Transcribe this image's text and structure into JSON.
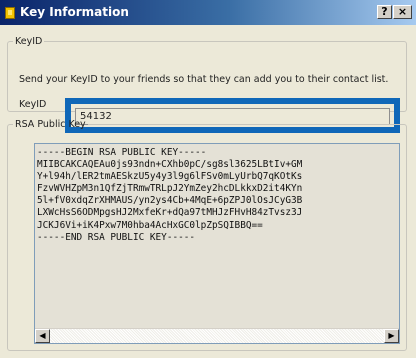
{
  "window": {
    "title": "Key Information",
    "help_label": "?",
    "close_label": "×"
  },
  "keyid_group": {
    "legend": "KeyID",
    "description": "Send your KeyID to your friends so that they can add you to their contact list.",
    "field_label": "KeyID",
    "field_value": "54132"
  },
  "rsa_group": {
    "legend": "RSA Public Key",
    "key_text": "-----BEGIN RSA PUBLIC KEY-----\nMIIBCAKCAQEAu0js93ndn+CXhb0pC/sg8sl3625LBtIv+GM\nY+l94h/lER2tmAESkzU5y4y3l9g6lFSv0mLyUrbQ7qKOtKs\nFzvWVHZpM3n1QfZjTRmwTRLpJ2YmZey2hcDLkkxD2it4KYn\n5l+fV0xdqZrXHMAUS/yn2ys4Cb+4MqE+6pZPJ0lOsJCyG3B\nLXWcHsS6ODMpgsHJ2MxfeKr+dQa97tMHJzFHvH84zTvsz3J\nJCKJ6Vi+iK4Pxw7M0hba4AcHxGC0lpZpSQIBBQ==\n-----END RSA PUBLIC KEY-----"
  },
  "scrollbar": {
    "left_arrow": "◀",
    "right_arrow": "▶"
  }
}
